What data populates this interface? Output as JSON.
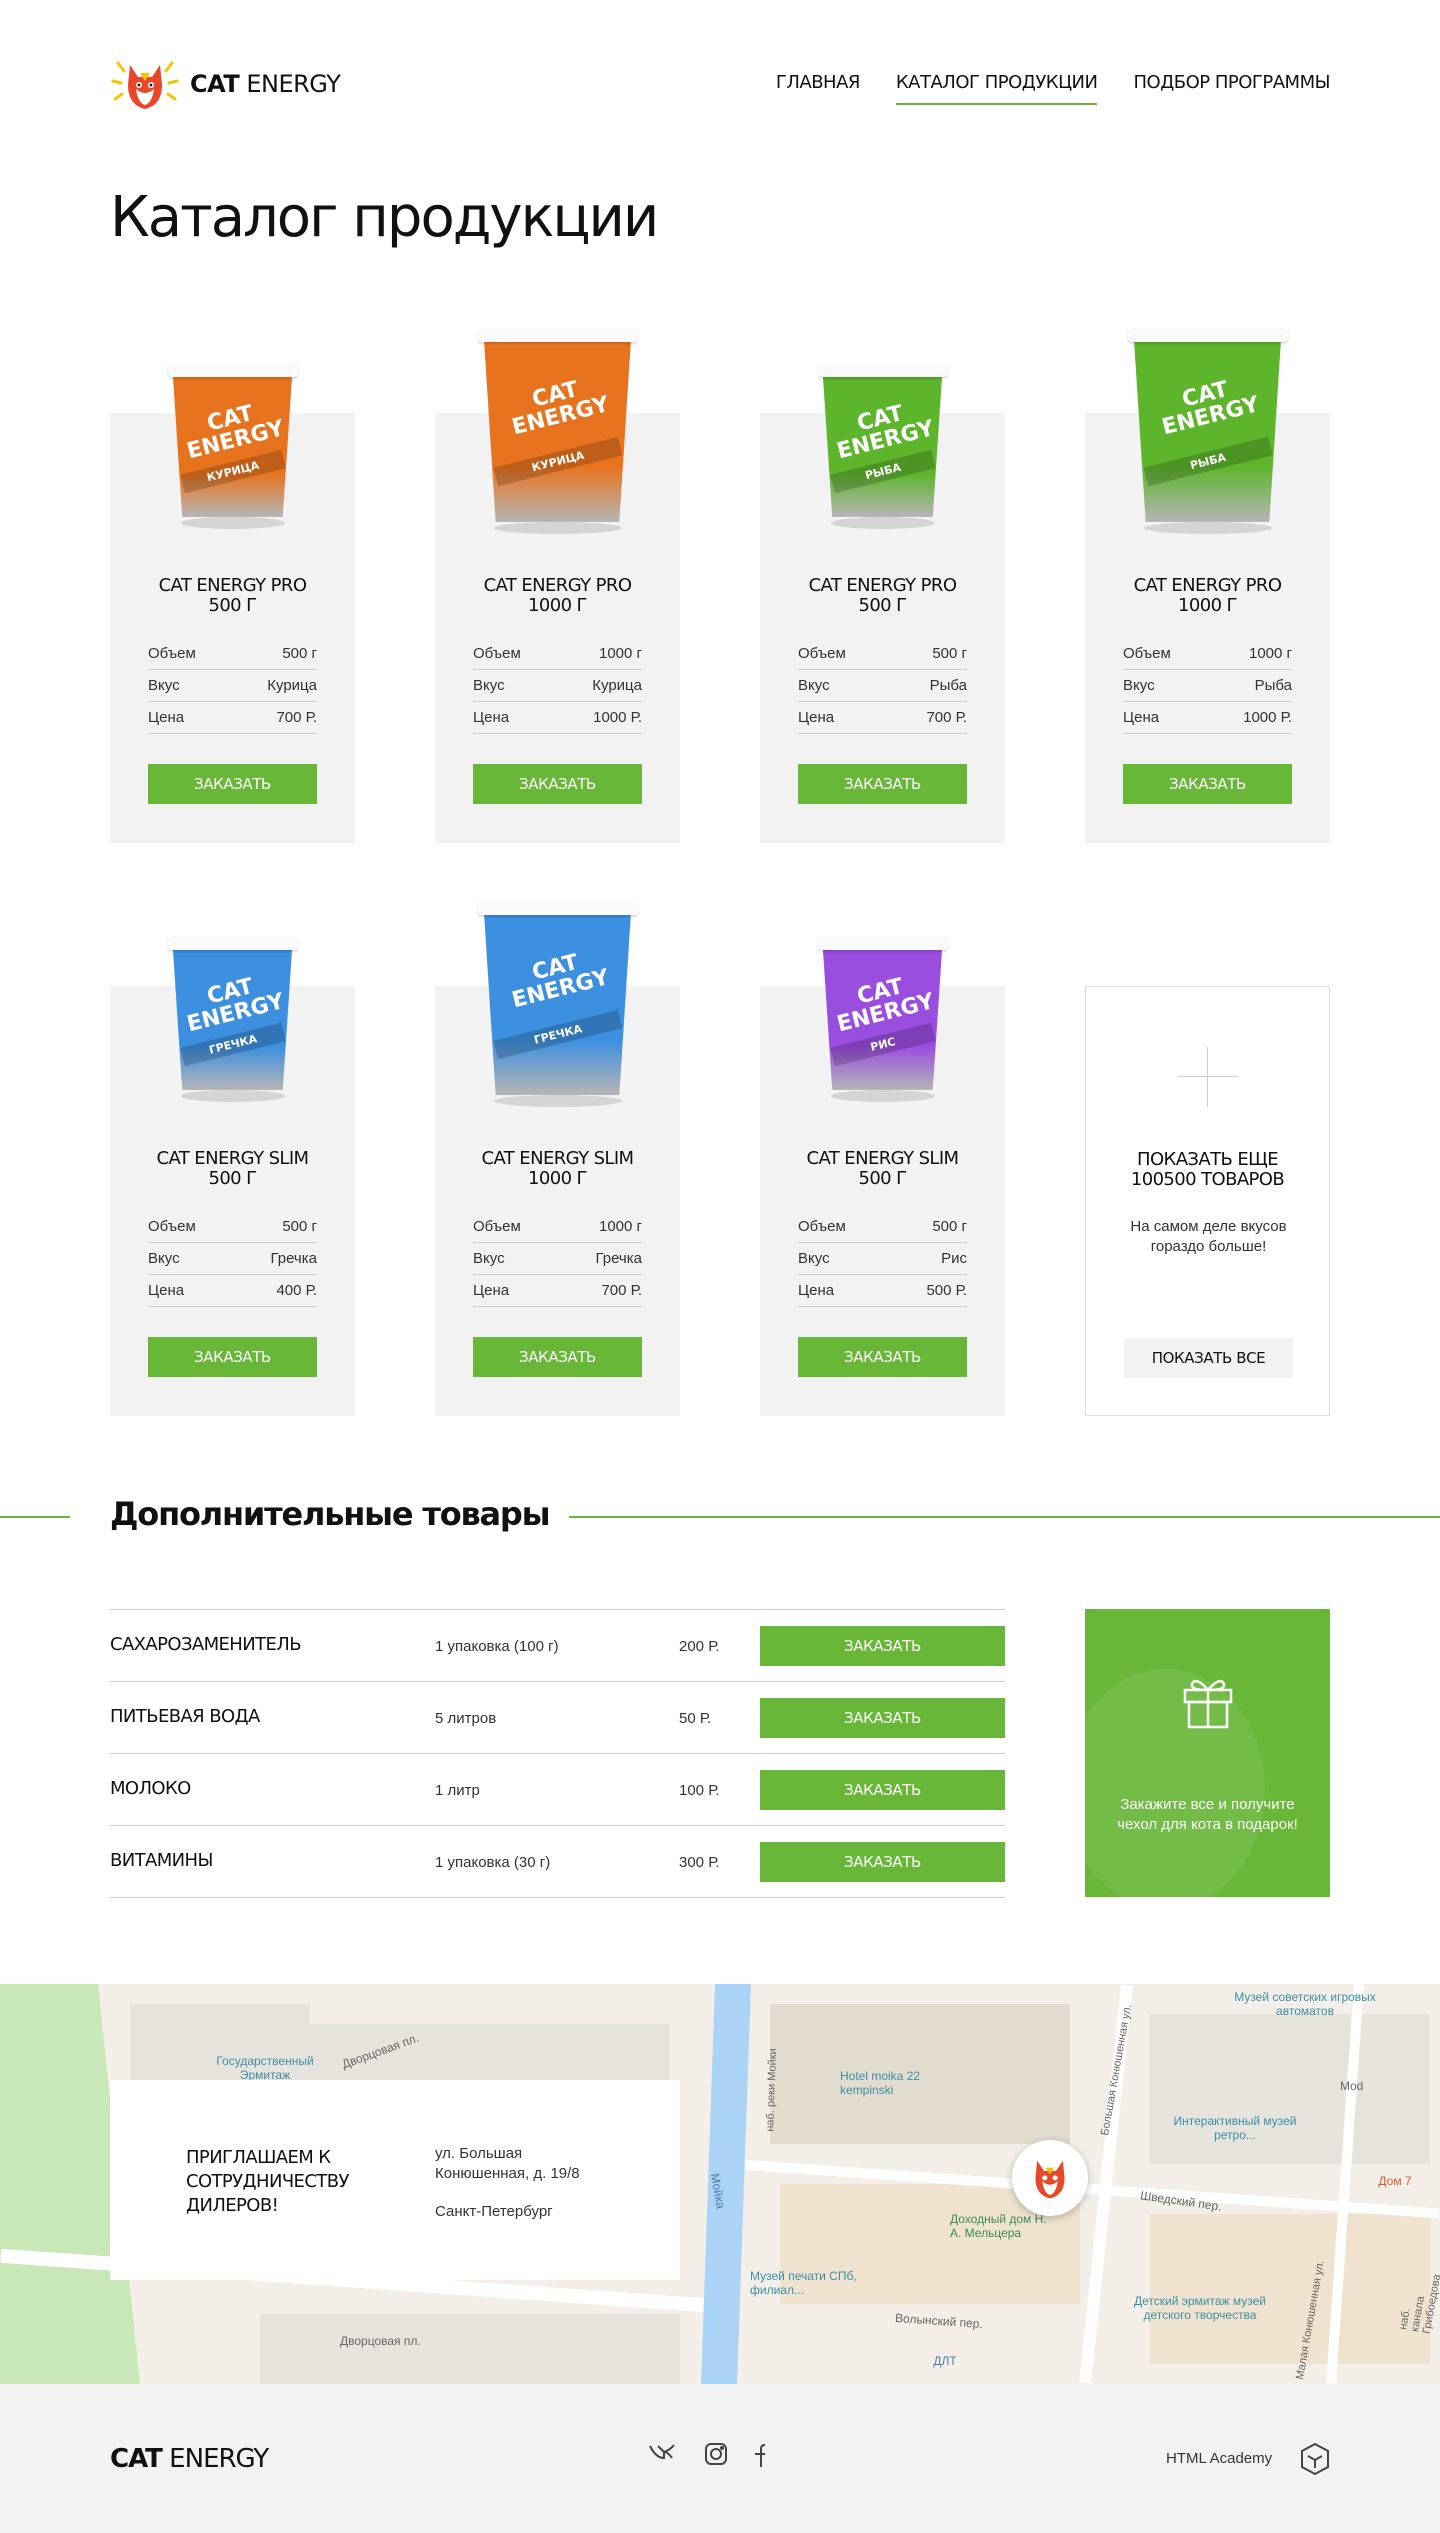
{
  "brand": {
    "bold": "CAT",
    "light": " ENERGY"
  },
  "nav": [
    {
      "label": "ГЛАВНАЯ"
    },
    {
      "label": "КАТАЛОГ ПРОДУКЦИИ"
    },
    {
      "label": "ПОДБОР ПРОГРАММЫ"
    }
  ],
  "page_title": "Каталог продукции",
  "cup_text": {
    "brand1": "CAT",
    "brand2": "ENERGY"
  },
  "products": [
    {
      "name": "CAT ENERGY PRO",
      "weight": "500 Г",
      "props": [
        [
          "Объем",
          "500 г"
        ],
        [
          "Вкус",
          "Курица"
        ],
        [
          "Цена",
          "700 Р."
        ]
      ],
      "order": "ЗАКАЗАТЬ",
      "flavor": "КУРИЦА",
      "color": "#e8731f"
    },
    {
      "name": "CAT ENERGY PRO",
      "weight": "1000 Г",
      "props": [
        [
          "Объем",
          "1000 г"
        ],
        [
          "Вкус",
          "Курица"
        ],
        [
          "Цена",
          "1000 Р."
        ]
      ],
      "order": "ЗАКАЗАТЬ",
      "flavor": "КУРИЦА",
      "color": "#e8731f"
    },
    {
      "name": "CAT ENERGY PRO",
      "weight": "500 Г",
      "props": [
        [
          "Объем",
          "500 г"
        ],
        [
          "Вкус",
          "Рыба"
        ],
        [
          "Цена",
          "700 Р."
        ]
      ],
      "order": "ЗАКАЗАТЬ",
      "flavor": "РЫБА",
      "color": "#5db52c"
    },
    {
      "name": "CAT ENERGY PRO",
      "weight": "1000 Г",
      "props": [
        [
          "Объем",
          "1000 г"
        ],
        [
          "Вкус",
          "Рыба"
        ],
        [
          "Цена",
          "1000 Р."
        ]
      ],
      "order": "ЗАКАЗАТЬ",
      "flavor": "РЫБА",
      "color": "#5db52c"
    },
    {
      "name": "CAT ENERGY SLIM",
      "weight": "500 Г",
      "props": [
        [
          "Объем",
          "500 г"
        ],
        [
          "Вкус",
          "Гречка"
        ],
        [
          "Цена",
          "400 Р."
        ]
      ],
      "order": "ЗАКАЗАТЬ",
      "flavor": "ГРЕЧКА",
      "color": "#3d8fe0"
    },
    {
      "name": "CAT ENERGY SLIM",
      "weight": "1000 Г",
      "props": [
        [
          "Объем",
          "1000 г"
        ],
        [
          "Вкус",
          "Гречка"
        ],
        [
          "Цена",
          "700 Р."
        ]
      ],
      "order": "ЗАКАЗАТЬ",
      "flavor": "ГРЕЧКА",
      "color": "#3d8fe0"
    },
    {
      "name": "CAT ENERGY SLIM",
      "weight": "500 Г",
      "props": [
        [
          "Объем",
          "500 г"
        ],
        [
          "Вкус",
          "Рис"
        ],
        [
          "Цена",
          "500 Р."
        ]
      ],
      "order": "ЗАКАЗАТЬ",
      "flavor": "РИС",
      "color": "#9a4ee0"
    }
  ],
  "more": {
    "title1": "ПОКАЗАТЬ ЕЩЕ",
    "title2": "100500 ТОВАРОВ",
    "text": "На самом деле вкусов гораздо больше!",
    "button": "ПОКАЗАТЬ ВСЕ"
  },
  "additional": {
    "title": "Дополнительные товары",
    "items": [
      {
        "name": "САХАРОЗАМЕНИТЕЛЬ",
        "qty": "1 упаковка (100 г)",
        "price": "200 Р.",
        "button": "ЗАКАЗАТЬ"
      },
      {
        "name": "ПИТЬЕВАЯ ВОДА",
        "qty": "5 литров",
        "price": "50 Р.",
        "button": "ЗАКАЗАТЬ"
      },
      {
        "name": "МОЛОКО",
        "qty": "1 литр",
        "price": "100 Р.",
        "button": "ЗАКАЗАТЬ"
      },
      {
        "name": "ВИТАМИНЫ",
        "qty": "1 упаковка (30 г)",
        "price": "300 Р.",
        "button": "ЗАКАЗАТЬ"
      }
    ],
    "gift_text": "Закажите все и получите чехол для кота в подарок!"
  },
  "map": {
    "labels": [
      "Государственный Эрмитаж",
      "Дворцовая пл.",
      "Дворцовая пл.",
      "Мойка",
      "наб. реки Мойки",
      "Hotel moika 22 kempinski",
      "Доходный дом Н. А. Мельцера",
      "Музей печати СПб, филиал...",
      "Шведский пер.",
      "Волынский пер.",
      "Детский эрмитаж музей детского творчества",
      "Интерактивный музей ретро...",
      "Музей советских игровых автоматов",
      "ДЛТ",
      "Дом 7",
      "Mod",
      "Большая Конюшенная ул.",
      "Малая Конюшенная ул.",
      "наб. канала Грибоедова"
    ]
  },
  "dealer": {
    "title": "ПРИГЛАШАЕМ К СОТРУДНИЧЕСТВУ ДИЛЕРОВ!",
    "address": "ул. Большая Конюшенная, д. 19/8",
    "city": "Санкт-Петербург"
  },
  "footer": {
    "academy": "HTML Academy",
    "social": [
      "vk-icon",
      "instagram-icon",
      "facebook-icon"
    ]
  }
}
